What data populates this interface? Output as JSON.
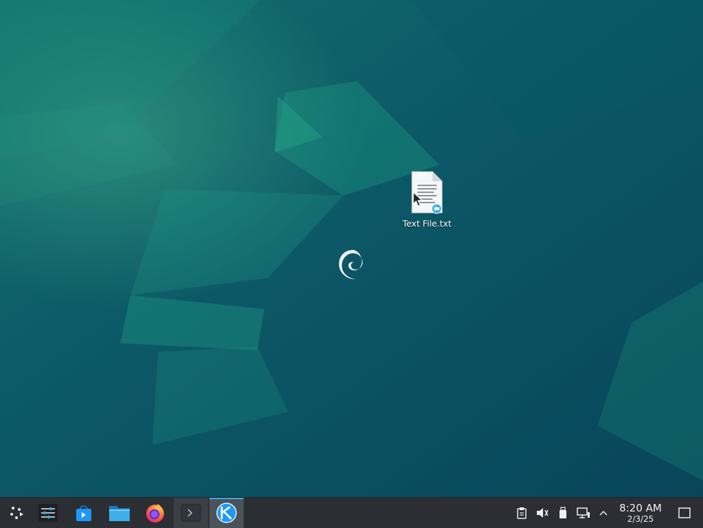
{
  "colors": {
    "wallpaper_base": "#0c4f5e",
    "taskbar_bg": "#2b2f34",
    "accent": "#3daee9",
    "text_light": "#eff0f1"
  },
  "desktop": {
    "icons": [
      {
        "label": "Text File.txt",
        "icon": "text-file-icon"
      }
    ],
    "center_logo": "debian-swirl-icon"
  },
  "taskbar": {
    "launchers": [
      {
        "icon": "app-launcher-icon"
      },
      {
        "icon": "system-settings-icon"
      },
      {
        "icon": "discover-store-icon"
      },
      {
        "icon": "file-manager-icon"
      },
      {
        "icon": "firefox-icon"
      }
    ],
    "tasks": [
      {
        "icon": "terminal-icon",
        "state": "inactive"
      },
      {
        "icon": "kde-app-icon",
        "state": "active"
      }
    ],
    "tray": [
      {
        "icon": "clipboard-icon"
      },
      {
        "icon": "volume-muted-icon"
      },
      {
        "icon": "usb-device-icon"
      },
      {
        "icon": "network-icon"
      },
      {
        "icon": "chevron-up-icon"
      }
    ],
    "clock": {
      "time": "8:20 AM",
      "date": "2/3/25"
    },
    "show_desktop": "show-desktop-icon"
  }
}
